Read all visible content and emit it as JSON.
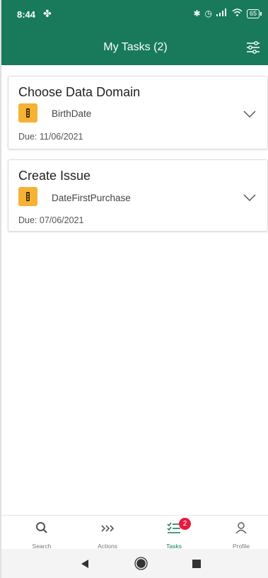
{
  "status_bar": {
    "time": "8:44",
    "battery": "65"
  },
  "header": {
    "title": "My Tasks (2)"
  },
  "tasks": [
    {
      "title": "Choose Data Domain",
      "subject": "BirthDate",
      "due": "Due: 11/06/2021"
    },
    {
      "title": "Create Issue",
      "subject": "DateFirstPurchase",
      "due": "Due: 07/06/2021"
    }
  ],
  "bottom_nav": {
    "items": [
      {
        "label": "Search",
        "icon": "search-icon"
      },
      {
        "label": "Actions",
        "icon": "actions-icon"
      },
      {
        "label": "Tasks",
        "icon": "tasks-icon",
        "badge": "2"
      },
      {
        "label": "Profile",
        "icon": "profile-icon"
      }
    ]
  },
  "colors": {
    "brand": "#187a5a",
    "icon_yellow": "#f5b234",
    "badge_red": "#e31c3d"
  }
}
